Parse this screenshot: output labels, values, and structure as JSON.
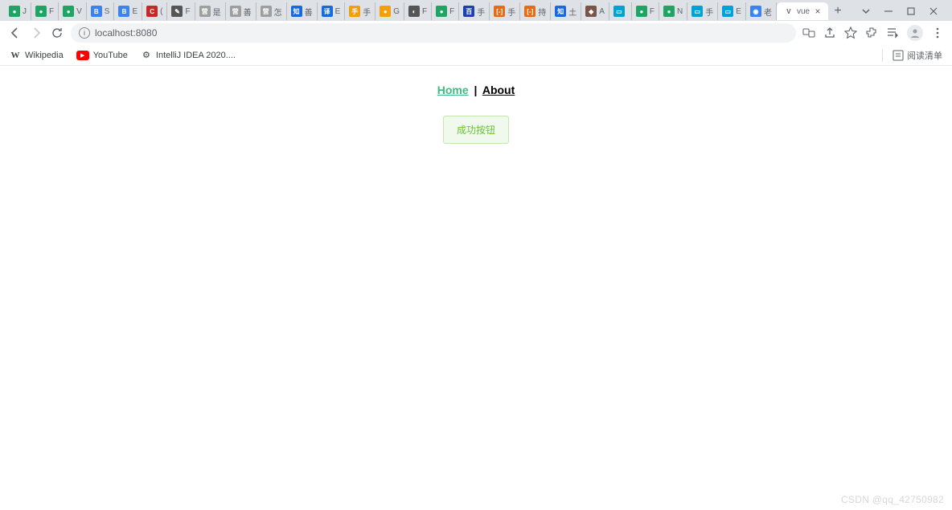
{
  "browser": {
    "tabs": [
      {
        "label": "J",
        "fav_bg": "#1fa463",
        "fav_txt": "●"
      },
      {
        "label": "F",
        "fav_bg": "#1fa463",
        "fav_txt": "●"
      },
      {
        "label": "V",
        "fav_bg": "#1fa463",
        "fav_txt": "●"
      },
      {
        "label": "S",
        "fav_bg": "#3b82f6",
        "fav_txt": "B"
      },
      {
        "label": "E",
        "fav_bg": "#3b82f6",
        "fav_txt": "B"
      },
      {
        "label": "(",
        "fav_bg": "#c62828",
        "fav_txt": "C"
      },
      {
        "label": "F",
        "fav_bg": "#555",
        "fav_txt": "✎"
      },
      {
        "label": "是",
        "fav_bg": "#9e9e9e",
        "fav_txt": "营"
      },
      {
        "label": "善",
        "fav_bg": "#9e9e9e",
        "fav_txt": "营"
      },
      {
        "label": "怎",
        "fav_bg": "#9e9e9e",
        "fav_txt": "营"
      },
      {
        "label": "善",
        "fav_bg": "#1769e0",
        "fav_txt": "知"
      },
      {
        "label": "E",
        "fav_bg": "#1769e0",
        "fav_txt": "译"
      },
      {
        "label": "手",
        "fav_bg": "#f59e0b",
        "fav_txt": "手"
      },
      {
        "label": "G",
        "fav_bg": "#f59e0b",
        "fav_txt": "●"
      },
      {
        "label": "F",
        "fav_bg": "#555",
        "fav_txt": "◐"
      },
      {
        "label": "F",
        "fav_bg": "#1fa463",
        "fav_txt": "●"
      },
      {
        "label": "手",
        "fav_bg": "#1e40af",
        "fav_txt": "百"
      },
      {
        "label": "手",
        "fav_bg": "#e56c17",
        "fav_txt": "[-]"
      },
      {
        "label": "持",
        "fav_bg": "#e56c17",
        "fav_txt": "[-]"
      },
      {
        "label": "土",
        "fav_bg": "#1769e0",
        "fav_txt": "知"
      },
      {
        "label": "A",
        "fav_bg": "#795548",
        "fav_txt": "◆"
      },
      {
        "label": "",
        "fav_bg": "#00a1d6",
        "fav_txt": "▭"
      },
      {
        "label": "F",
        "fav_bg": "#1fa463",
        "fav_txt": "●"
      },
      {
        "label": "N",
        "fav_bg": "#1fa463",
        "fav_txt": "●"
      },
      {
        "label": "手",
        "fav_bg": "#00a1d6",
        "fav_txt": "▭"
      },
      {
        "label": "E",
        "fav_bg": "#00a1d6",
        "fav_txt": "▭"
      },
      {
        "label": "老",
        "fav_bg": "#3b82f6",
        "fav_txt": "◉"
      }
    ],
    "active_tab": {
      "label": "vue",
      "fav_txt": "V",
      "fav_bg": "#fff"
    },
    "address": "localhost:8080",
    "bookmarks": [
      {
        "label": "Wikipedia",
        "icon": "W"
      },
      {
        "label": "YouTube",
        "icon": "▶"
      },
      {
        "label": "IntelliJ IDEA 2020....",
        "icon": "⚙"
      }
    ],
    "reading_list": "阅读清单"
  },
  "page": {
    "nav": {
      "home": "Home",
      "sep": "|",
      "about": "About"
    },
    "button_label": "成功按钮"
  },
  "watermark": "CSDN @qq_42750982"
}
